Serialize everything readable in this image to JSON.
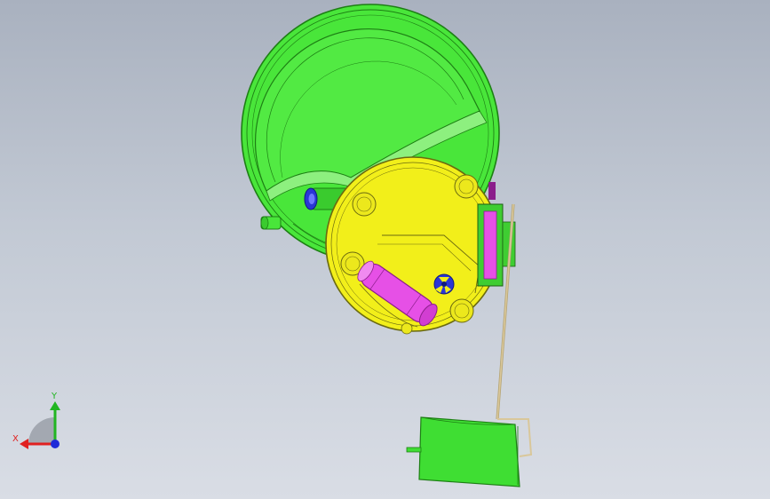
{
  "viewport": {
    "background_top": "#a9b1bf",
    "background_bottom": "#d9dde5"
  },
  "model": {
    "colors": {
      "tank_green": "#49e63a",
      "tank_green_dark": "#1d7f14",
      "cover_yellow": "#f2ef1a",
      "cover_outline": "#6b6a10",
      "pump_magenta": "#e650e6",
      "pump_magenta_dark": "#8b1e8b",
      "sensor_blue": "#2a36d6",
      "wire_tan": "#d9c79a",
      "float_green": "#3fde33"
    },
    "parts": [
      {
        "name": "fuel-tank-housing",
        "icon": "tank-icon"
      },
      {
        "name": "top-cover-flange",
        "icon": "cover-icon"
      },
      {
        "name": "fuel-pump",
        "icon": "pump-icon"
      },
      {
        "name": "level-sensor-float",
        "icon": "float-icon"
      }
    ]
  },
  "triad": {
    "x_label": "X",
    "y_label": "Y",
    "x_color": "#e02020",
    "y_color": "#21b521",
    "z_color": "#1f2bd8"
  }
}
